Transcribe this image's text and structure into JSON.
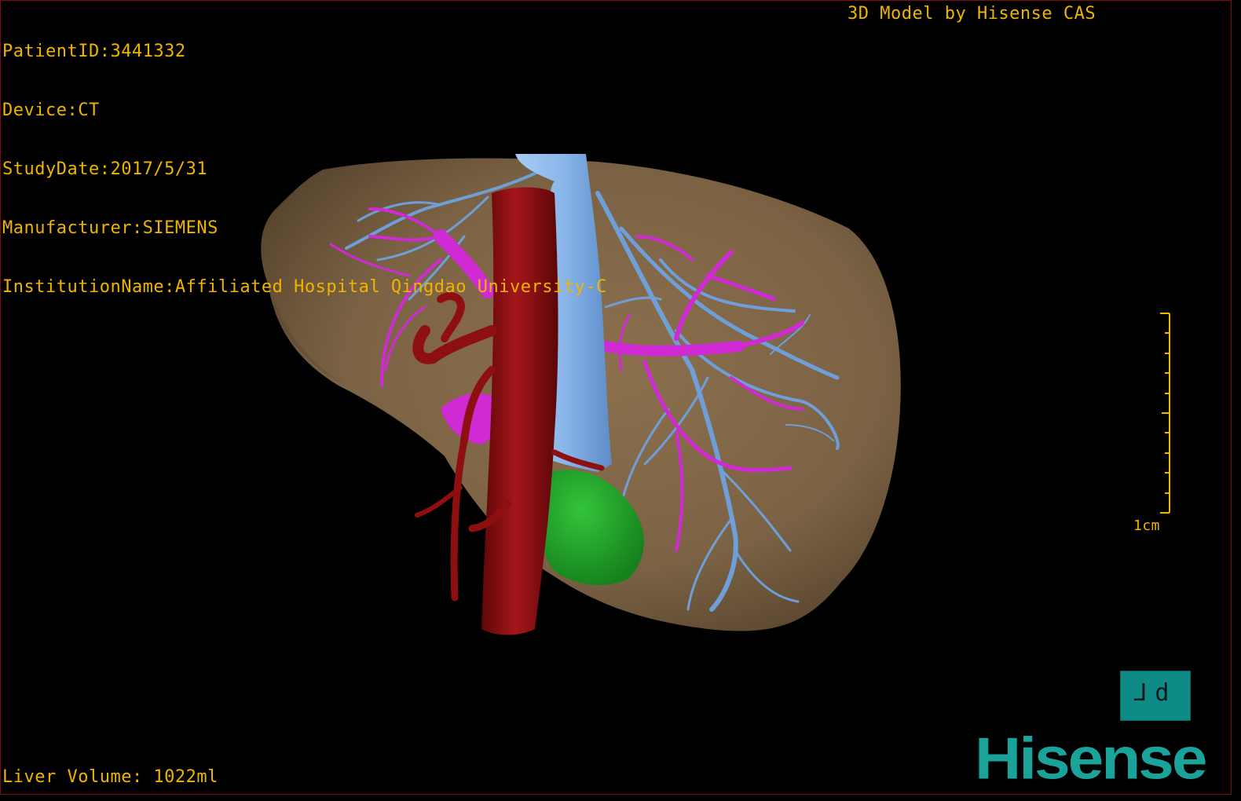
{
  "header": {
    "patient_id": "PatientID:3441332",
    "device": "Device:CT",
    "study_date": "StudyDate:2017/5/31",
    "manufacturer": "Manufacturer:SIEMENS",
    "institution": "InstitutionName:Affiliated Hospital Qingdao University-C"
  },
  "credit": "3D Model by Hisense CAS",
  "footer": {
    "liver_volume": "Liver Volume: 1022ml"
  },
  "scale_bar": {
    "label": "1cm"
  },
  "view_cube": {
    "label": "⅃d"
  },
  "brand": {
    "logo_text": "Hisense"
  },
  "colors": {
    "overlay_text": "#f0b400",
    "liver": "#7b6244",
    "hepatic_vein": "#6f9fd8",
    "portal_vein": "#d02ad4",
    "aorta": "#8e0f10",
    "tumor": "#1fa12a",
    "brand": "#1aa39b"
  }
}
